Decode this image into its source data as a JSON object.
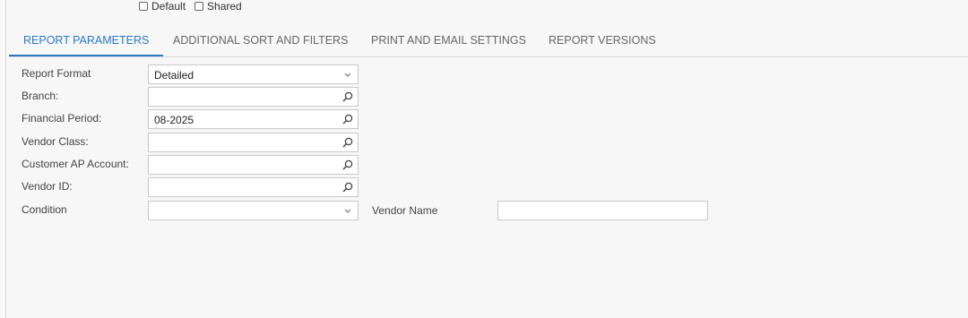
{
  "options": {
    "default_label": "Default",
    "shared_label": "Shared"
  },
  "tabs": [
    {
      "label": "REPORT PARAMETERS"
    },
    {
      "label": "ADDITIONAL SORT AND FILTERS"
    },
    {
      "label": "PRINT AND EMAIL SETTINGS"
    },
    {
      "label": "REPORT VERSIONS"
    }
  ],
  "active_tab": "REPORT PARAMETERS",
  "fields": {
    "report_format": {
      "label": "Report Format",
      "value": "Detailed",
      "icon": "chevron-down-icon"
    },
    "branch": {
      "label": "Branch:",
      "value": "",
      "icon": "search-icon"
    },
    "financial_period": {
      "label": "Financial Period:",
      "value": "08-2025",
      "icon": "search-icon"
    },
    "vendor_class": {
      "label": "Vendor Class:",
      "value": "",
      "icon": "search-icon"
    },
    "customer_ap_account": {
      "label": "Customer AP Account:",
      "value": "",
      "icon": "search-icon"
    },
    "vendor_id": {
      "label": "Vendor ID:",
      "value": "",
      "icon": "search-icon"
    },
    "condition": {
      "label": "Condition",
      "value": "",
      "icon": "chevron-down-icon"
    },
    "vendor_name": {
      "label": "Vendor Name",
      "value": ""
    }
  },
  "colors": {
    "accent": "#2b78c5",
    "background": "#f7f7f7"
  }
}
